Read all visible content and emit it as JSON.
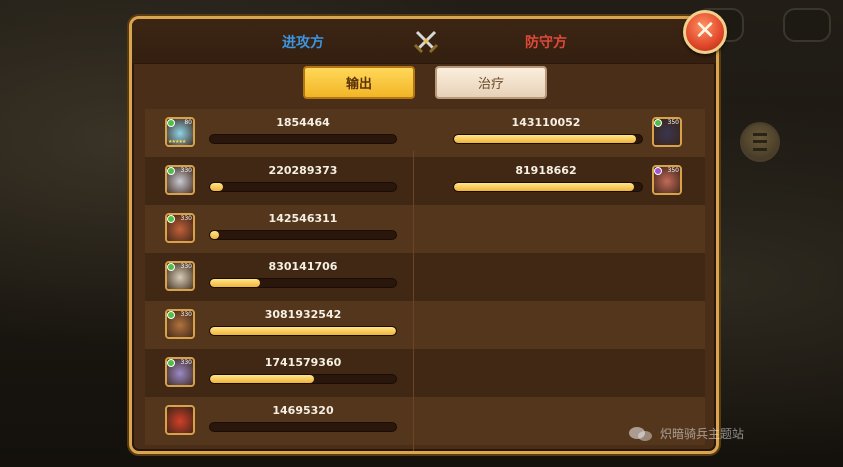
{
  "panel": {
    "attacker_title": "进攻方",
    "defender_title": "防守方",
    "tabs": [
      {
        "label": "输出",
        "active": true
      },
      {
        "label": "治疗",
        "active": false
      }
    ],
    "close_icon": "close-icon"
  },
  "attackers": [
    {
      "damage": "1854464",
      "fill": 0.0,
      "level": "80",
      "badge_color": "#4ec04a",
      "stars": "★★★★★",
      "portrait_color": "#8fd3e8"
    },
    {
      "damage": "220289373",
      "fill": 0.07,
      "level": "330",
      "badge_color": "#4ec04a",
      "stars": "",
      "portrait_color": "#c9c9d4"
    },
    {
      "damage": "142546311",
      "fill": 0.05,
      "level": "330",
      "badge_color": "#4ec04a",
      "stars": "",
      "portrait_color": "#c0603a"
    },
    {
      "damage": "830141706",
      "fill": 0.27,
      "level": "330",
      "badge_color": "#4ec04a",
      "stars": "",
      "portrait_color": "#d7cdb8"
    },
    {
      "damage": "3081932542",
      "fill": 1.0,
      "level": "330",
      "badge_color": "#4ec04a",
      "stars": "",
      "portrait_color": "#b0723e"
    },
    {
      "damage": "1741579360",
      "fill": 0.56,
      "level": "330",
      "badge_color": "#4ec04a",
      "stars": "",
      "portrait_color": "#9b8ac8"
    },
    {
      "damage": "14695320",
      "fill": 0.0,
      "level": "",
      "badge_color": "",
      "stars": "",
      "portrait_color": "#d0402a"
    }
  ],
  "defenders": [
    {
      "damage": "143110052",
      "fill": 0.97,
      "level": "350",
      "badge_color": "#4ec04a",
      "portrait_color": "#3a3550"
    },
    {
      "damage": "81918662",
      "fill": 0.96,
      "level": "350",
      "badge_color": "#a055d0",
      "portrait_color": "#c26a5a"
    }
  ],
  "watermark": {
    "text": "炽暗骑兵主题站"
  }
}
